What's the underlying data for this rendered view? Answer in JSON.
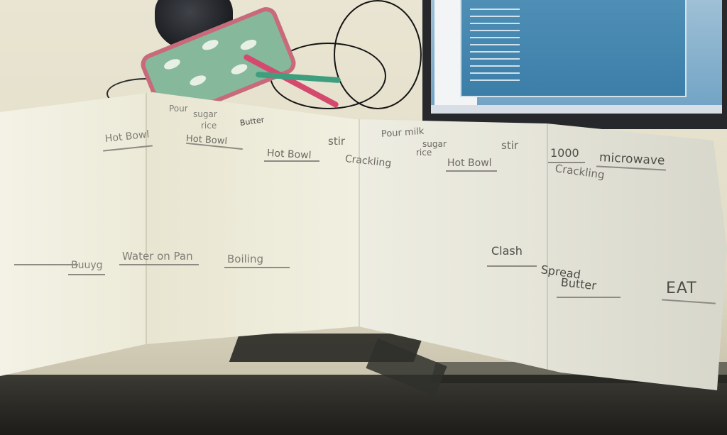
{
  "photo": {
    "subject": "handwritten paper strip storyboard"
  },
  "notes": {
    "top": [
      "Hot Bowl",
      "Pour",
      "sugar",
      "rice",
      "Butter",
      "Hot Bowl",
      "stir",
      "Hot Bowl",
      "Crackling",
      "Pour milk",
      "sugar",
      "rice",
      "Hot Bowl",
      "stir",
      "1000",
      "microwave",
      "Crackling"
    ],
    "bottom": [
      "Buuyg",
      "Water on Pan",
      "Boiling",
      "Clash",
      "Spread",
      "Butter",
      "EAT"
    ]
  }
}
